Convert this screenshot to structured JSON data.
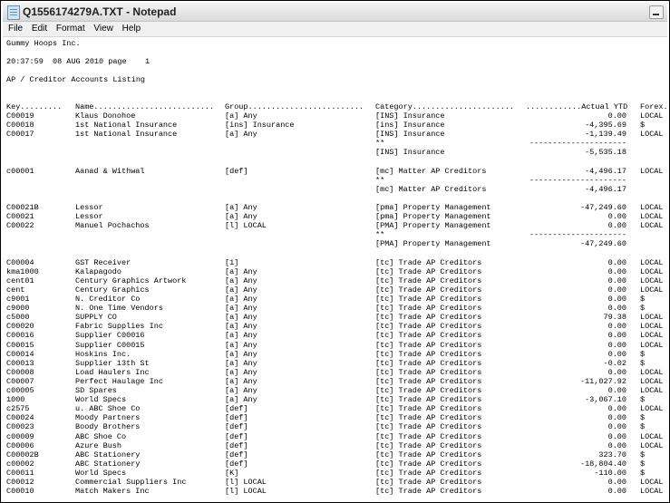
{
  "window": {
    "title": "Q1556174279A.TXT - Notepad",
    "icon": "notepad-icon",
    "minimize_icon": "minimize-icon"
  },
  "menu": [
    "File",
    "Edit",
    "Format",
    "View",
    "Help"
  ],
  "report": {
    "company": "Gummy Hoops Inc.",
    "timestamp": "20:37:59  08 AUG 2010 page    1",
    "title": "AP / Creditor Accounts Listing",
    "columns": {
      "key": "Key.........",
      "name": "Name..........................",
      "group": "Group.........................",
      "category": "Category......................",
      "amount": "............Actual YTD",
      "forex": "Forex."
    },
    "rows": [
      {
        "key": "C00019",
        "name": "Klaus Donohoe",
        "group": "[a] Any",
        "cat": "[INS] Insurance",
        "amt": "0.00",
        "fx": "LOCAL"
      },
      {
        "key": "C00018",
        "name": "1st National Insurance",
        "group": "[ins] Insurance",
        "cat": "[ins] Insurance",
        "amt": "-4,395.69",
        "fx": "$"
      },
      {
        "key": "C00017",
        "name": "1st National Insurance",
        "group": "[a] Any",
        "cat": "[INS] Insurance",
        "amt": "-1,139.49",
        "fx": "LOCAL"
      },
      {
        "key": "",
        "name": "",
        "group": "",
        "cat": "**",
        "amt": "---------------------",
        "fx": ""
      },
      {
        "key": "",
        "name": "",
        "group": "",
        "cat": "[INS] Insurance",
        "amt": "-5,535.18",
        "fx": ""
      },
      {
        "key": "",
        "name": "",
        "group": "",
        "cat": "",
        "amt": "",
        "fx": ""
      },
      {
        "key": "c00001",
        "name": "Aanad & Withwal",
        "group": "[def]",
        "cat": "[mc] Matter AP Creditors",
        "amt": "-4,496.17",
        "fx": "LOCAL"
      },
      {
        "key": "",
        "name": "",
        "group": "",
        "cat": "**",
        "amt": "---------------------",
        "fx": ""
      },
      {
        "key": "",
        "name": "",
        "group": "",
        "cat": "[mc] Matter AP Creditors",
        "amt": "-4,496.17",
        "fx": ""
      },
      {
        "key": "",
        "name": "",
        "group": "",
        "cat": "",
        "amt": "",
        "fx": ""
      },
      {
        "key": "C00021B",
        "name": "Lessor",
        "group": "[a] Any",
        "cat": "[pma] Property Management",
        "amt": "-47,249.60",
        "fx": "LOCAL"
      },
      {
        "key": "C00021",
        "name": "Lessor",
        "group": "[a] Any",
        "cat": "[pma] Property Management",
        "amt": "0.00",
        "fx": "LOCAL"
      },
      {
        "key": "C00022",
        "name": "Manuel Pochachos",
        "group": "[l] LOCAL",
        "cat": "[PMA] Property Management",
        "amt": "0.00",
        "fx": "LOCAL"
      },
      {
        "key": "",
        "name": "",
        "group": "",
        "cat": "**",
        "amt": "---------------------",
        "fx": ""
      },
      {
        "key": "",
        "name": "",
        "group": "",
        "cat": "[PMA] Property Management",
        "amt": "-47,249.60",
        "fx": ""
      },
      {
        "key": "",
        "name": "",
        "group": "",
        "cat": "",
        "amt": "",
        "fx": ""
      },
      {
        "key": "C00004",
        "name": "GST Receiver",
        "group": "[1]",
        "cat": "[tc] Trade AP Creditors",
        "amt": "0.00",
        "fx": "LOCAL"
      },
      {
        "key": "kma1000",
        "name": "Kalapagodo",
        "group": "[a] Any",
        "cat": "[tc] Trade AP Creditors",
        "amt": "0.00",
        "fx": "LOCAL"
      },
      {
        "key": "cent01",
        "name": "Century Graphics Artwork",
        "group": "[a] Any",
        "cat": "[tc] Trade AP Creditors",
        "amt": "0.00",
        "fx": "LOCAL"
      },
      {
        "key": "cent",
        "name": "Century Graphics",
        "group": "[a] Any",
        "cat": "[tc] Trade AP Creditors",
        "amt": "0.00",
        "fx": "LOCAL"
      },
      {
        "key": "c9001",
        "name": "N. Creditor Co",
        "group": "[a] Any",
        "cat": "[tc] Trade AP Creditors",
        "amt": "0.00",
        "fx": "$"
      },
      {
        "key": "c9000",
        "name": "N. One Time Vendors",
        "group": "[a] Any",
        "cat": "[tc] Trade AP Creditors",
        "amt": "0.00",
        "fx": "$"
      },
      {
        "key": "c5000",
        "name": "SUPPLY CO",
        "group": "[a] Any",
        "cat": "[tc] Trade AP Creditors",
        "amt": "79.38",
        "fx": "LOCAL"
      },
      {
        "key": "C00020",
        "name": "Fabric Supplies Inc",
        "group": "[a] Any",
        "cat": "[tc] Trade AP Creditors",
        "amt": "0.00",
        "fx": "LOCAL"
      },
      {
        "key": "C00016",
        "name": "Supplier C00016",
        "group": "[a] Any",
        "cat": "[tc] Trade AP Creditors",
        "amt": "0.00",
        "fx": "LOCAL"
      },
      {
        "key": "C00015",
        "name": "Supplier C00015",
        "group": "[a] Any",
        "cat": "[tc] Trade AP Creditors",
        "amt": "0.00",
        "fx": "LOCAL"
      },
      {
        "key": "C00014",
        "name": "Hoskins Inc.",
        "group": "[a] Any",
        "cat": "[tc] Trade AP Creditors",
        "amt": "0.00",
        "fx": "$"
      },
      {
        "key": "C00013",
        "name": "Supplier 13th St",
        "group": "[a] Any",
        "cat": "[tc] Trade AP Creditors",
        "amt": "-0.02",
        "fx": "$"
      },
      {
        "key": "C00008",
        "name": "Load Haulers Inc",
        "group": "[a] Any",
        "cat": "[tc] Trade AP Creditors",
        "amt": "0.00",
        "fx": "LOCAL"
      },
      {
        "key": "C00007",
        "name": "Perfect Haulage Inc",
        "group": "[a] Any",
        "cat": "[tc] Trade AP Creditors",
        "amt": "-11,027.92",
        "fx": "LOCAL"
      },
      {
        "key": "c00005",
        "name": "SD Spares",
        "group": "[a] Any",
        "cat": "[tc] Trade AP Creditors",
        "amt": "0.00",
        "fx": "LOCAL"
      },
      {
        "key": "1000",
        "name": "World Specs",
        "group": "[a] Any",
        "cat": "[tc] Trade AP Creditors",
        "amt": "-3,067.10",
        "fx": "$"
      },
      {
        "key": "c2575",
        "name": "u. ABC Shoe Co",
        "group": "[def]",
        "cat": "[tc] Trade AP Creditors",
        "amt": "0.00",
        "fx": "LOCAL"
      },
      {
        "key": "C00024",
        "name": "Moody Partners",
        "group": "[def]",
        "cat": "[tc] Trade AP Creditors",
        "amt": "0.00",
        "fx": "$"
      },
      {
        "key": "C00023",
        "name": "Boody Brothers",
        "group": "[def]",
        "cat": "[tc] Trade AP Creditors",
        "amt": "0.00",
        "fx": "$"
      },
      {
        "key": "c00009",
        "name": "ABC Shoe Co",
        "group": "[def]",
        "cat": "[tc] Trade AP Creditors",
        "amt": "0.00",
        "fx": "LOCAL"
      },
      {
        "key": "C00006",
        "name": "Azure Bush",
        "group": "[def]",
        "cat": "[tc] Trade AP Creditors",
        "amt": "0.00",
        "fx": "LOCAL"
      },
      {
        "key": "C00002B",
        "name": "ABC Stationery",
        "group": "[def]",
        "cat": "[tc] Trade AP Creditors",
        "amt": "323.70",
        "fx": "$"
      },
      {
        "key": "c00002",
        "name": "ABC Stationery",
        "group": "[def]",
        "cat": "[tc] Trade AP Creditors",
        "amt": "-18,804.40",
        "fx": "$"
      },
      {
        "key": "C00011",
        "name": "World Specs",
        "group": "[K]",
        "cat": "[tc] Trade AP Creditors",
        "amt": "-110.00",
        "fx": "$"
      },
      {
        "key": "C00012",
        "name": "Commercial Suppliers Inc",
        "group": "[l] LOCAL",
        "cat": "[tc] Trade AP Creditors",
        "amt": "0.00",
        "fx": "LOCAL"
      },
      {
        "key": "C00010",
        "name": "Match Makers Inc",
        "group": "[l] LOCAL",
        "cat": "[tc] Trade AP Creditors",
        "amt": "0.00",
        "fx": "LOCAL"
      }
    ]
  }
}
